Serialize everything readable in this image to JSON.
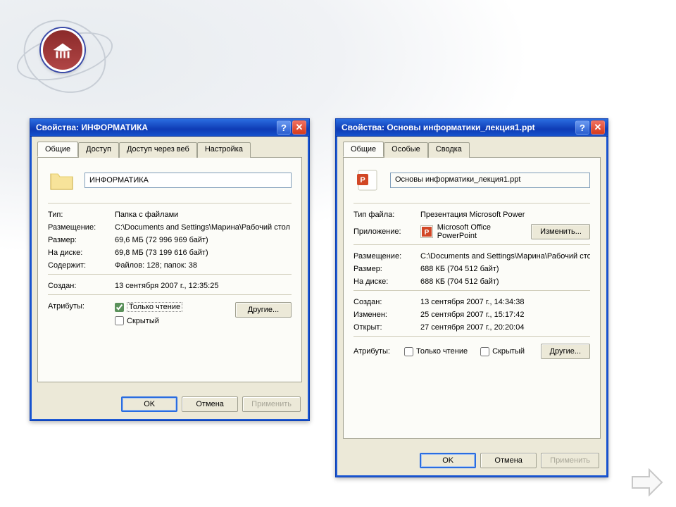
{
  "left": {
    "title": "Свойства: ИНФОРМАТИКА",
    "tabs": [
      "Общие",
      "Доступ",
      "Доступ через веб",
      "Настройка"
    ],
    "name": "ИНФОРМАТИКА",
    "labels": {
      "type": "Тип:",
      "location": "Размещение:",
      "size": "Размер:",
      "ondisk": "На диске:",
      "contains": "Содержит:",
      "created": "Создан:",
      "attrs": "Атрибуты:"
    },
    "values": {
      "type": "Папка с файлами",
      "location": "C:\\Documents and Settings\\Марина\\Рабочий стол",
      "size": "69,6 МБ (72 996 969 байт)",
      "ondisk": "69,8 МБ (73 199 616 байт)",
      "contains": "Файлов: 128; папок: 38",
      "created": "13 сентября 2007 г., 12:35:25"
    },
    "checkbox": {
      "ro": "Только чтение",
      "hidden": "Скрытый"
    },
    "other_btn": "Другие...",
    "ok": "OK",
    "cancel": "Отмена",
    "apply": "Применить"
  },
  "right": {
    "title": "Свойства: Основы информатики_лекция1.ppt",
    "tabs": [
      "Общие",
      "Особые",
      "Сводка"
    ],
    "name": "Основы информатики_лекция1.ppt",
    "labels": {
      "ftype": "Тип файла:",
      "app": "Приложение:",
      "location": "Размещение:",
      "size": "Размер:",
      "ondisk": "На диске:",
      "created": "Создан:",
      "modified": "Изменен:",
      "opened": "Открыт:",
      "attrs": "Атрибуты:"
    },
    "values": {
      "ftype": "Презентация Microsoft Power",
      "app": "Microsoft Office PowerPoint",
      "location": "C:\\Documents and Settings\\Марина\\Рабочий стол\\И",
      "size": "688 КБ (704 512 байт)",
      "ondisk": "688 КБ (704 512 байт)",
      "created": "13 сентября 2007 г., 14:34:38",
      "modified": "25 сентября 2007 г., 15:17:42",
      "opened": "27 сентября 2007 г., 20:20:04"
    },
    "change_btn": "Изменить...",
    "checkbox": {
      "ro": "Только чтение",
      "hidden": "Скрытый"
    },
    "other_btn": "Другие...",
    "ok": "OK",
    "cancel": "Отмена",
    "apply": "Применить"
  }
}
